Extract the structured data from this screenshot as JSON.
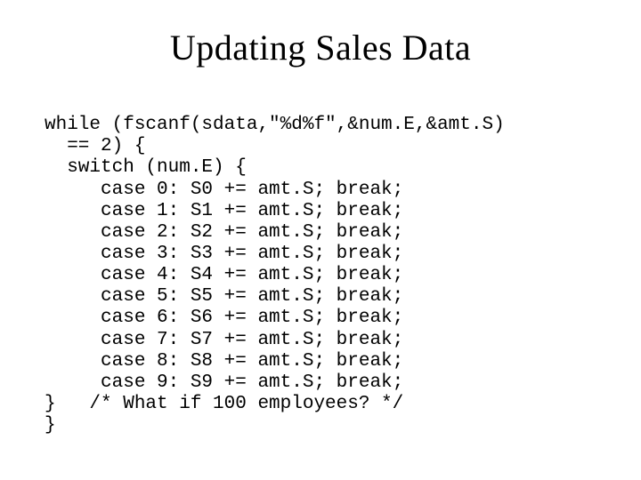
{
  "title": "Updating Sales Data",
  "code": {
    "l01": "while (fscanf(sdata,\"%d%f\",&num.E,&amt.S)",
    "l02": "  == 2) {",
    "l03": "  switch (num.E) {",
    "l04": "     case 0: S0 += amt.S; break;",
    "l05": "     case 1: S1 += amt.S; break;",
    "l06": "     case 2: S2 += amt.S; break;",
    "l07": "     case 3: S3 += amt.S; break;",
    "l08": "     case 4: S4 += amt.S; break;",
    "l09": "     case 5: S5 += amt.S; break;",
    "l10": "     case 6: S6 += amt.S; break;",
    "l11": "     case 7: S7 += amt.S; break;",
    "l12": "     case 8: S8 += amt.S; break;",
    "l13": "     case 9: S9 += amt.S; break;",
    "l14": "}   /* What if 100 employees? */",
    "l15": "}"
  }
}
